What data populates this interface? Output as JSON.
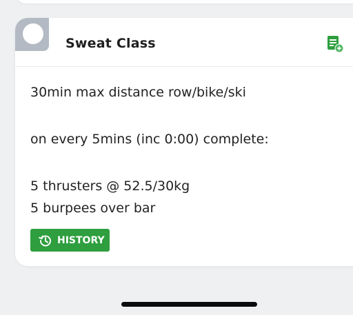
{
  "card": {
    "title": "Sweat Class",
    "lines": [
      "30min max distance row/bike/ski",
      "on every 5mins (inc 0:00) complete:",
      "5 thrusters @ 52.5/30kg",
      "5 burpees over bar"
    ],
    "history_label": "HISTORY"
  },
  "icons": {
    "avatar": "avatar-placeholder-icon",
    "add_log": "add-log-icon",
    "history": "history-icon"
  },
  "colors": {
    "accent_green": "#2e9e3e",
    "avatar_gray": "#b3bac3",
    "background": "#eef0f2"
  }
}
